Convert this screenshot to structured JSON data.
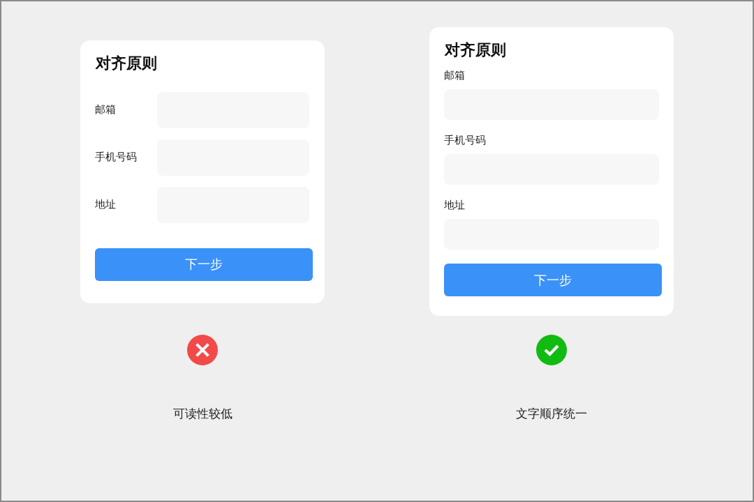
{
  "panels": [
    {
      "kind": "inline",
      "title": "对齐原则",
      "fields": [
        {
          "label": "邮箱"
        },
        {
          "label": "手机号码"
        },
        {
          "label": "地址"
        }
      ],
      "button": "下一步",
      "verdict": {
        "kind": "cross"
      },
      "caption": "可读性较低"
    },
    {
      "kind": "stacked",
      "title": "对齐原则",
      "fields": [
        {
          "label": "邮箱"
        },
        {
          "label": "手机号码"
        },
        {
          "label": "地址"
        }
      ],
      "button": "下一步",
      "verdict": {
        "kind": "check"
      },
      "caption": "文字顺序统一"
    }
  ]
}
